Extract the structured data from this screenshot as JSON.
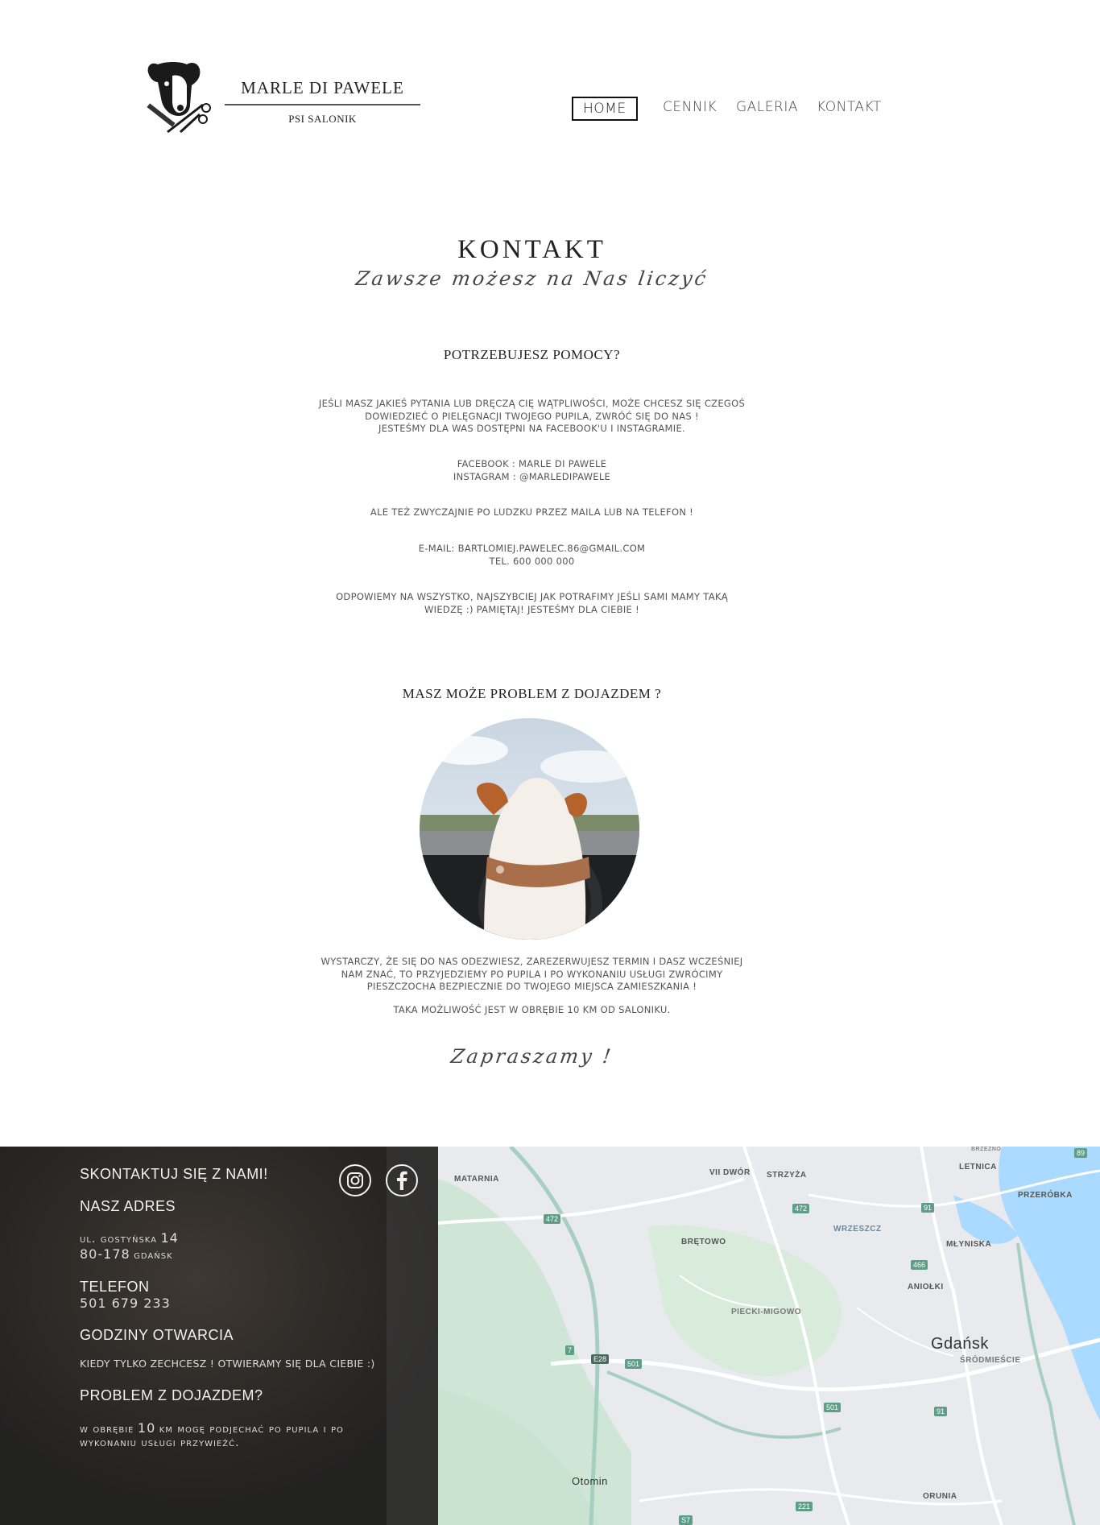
{
  "header": {
    "brand_name": "MARLE DI PAWELE",
    "brand_sub": "PSI SALONIK",
    "nav": [
      {
        "label": "HOME",
        "active": true
      },
      {
        "label": "CENNIK",
        "active": false
      },
      {
        "label": "GALERIA",
        "active": false
      },
      {
        "label": "KONTAKT",
        "active": false
      }
    ]
  },
  "main": {
    "title": "KONTAKT",
    "tagline": "Zawsze możesz na Nas liczyć",
    "help_heading": "POTRZEBUJESZ POMOCY?",
    "help_p1_l1": "JEŚLI MASZ JAKIEŚ PYTANIA LUB DRĘCZĄ CIĘ WĄTPLIWOŚCI, MOŻE CHCESZ SIĘ CZEGOŚ",
    "help_p1_l2": "DOWIEDZIEĆ O PIELĘGNACJI TWOJEGO PUPILA, ZWRÓĆ SIĘ DO NAS !",
    "help_p1_l3": "JESTEŚMY DLA WAS DOSTĘPNI NA FACEBOOK'U  I INSTAGRAMIE.",
    "facebook_line": "FACEBOOK : MARLE DI PAWELE",
    "instagram_line": "INSTAGRAM : @MARLEDIPAWELE",
    "help_p3": "ALE TEŻ ZWYCZAJNIE PO LUDZKU PRZEZ MAILA LUB NA TELEFON !",
    "email_line": "E-MAIL: BARTLOMIEJ.PAWELEC.86@GMAIL.COM",
    "tel_line": "TEL. 600 000 000",
    "help_p5_l1": "ODPOWIEMY NA WSZYSTKO, NAJSZYBCIEJ JAK POTRAFIMY JEŚLI SAMI MAMY TAKĄ",
    "help_p5_l2": "WIEDZĘ :) PAMIĘTAJ! JESTEŚMY DLA CIEBIE !",
    "transport_heading": "MASZ MOŻE PROBLEM Z DOJAZDEM ?",
    "transport_p1_l1": "WYSTARCZY, ŻE SIĘ DO NAS ODEZWIESZ, ZAREZERWUJESZ TERMIN I DASZ WCZEŚNIEJ",
    "transport_p1_l2": "NAM ZNAĆ, TO PRZYJEDZIEMY PO PUPILA I PO WYKONANIU USŁUGI ZWRÓCIMY",
    "transport_p1_l3": "PIESZCZOCHA BEZPIECZNIE DO TWOJEGO MIEJSCA ZAMIESZKANIA !",
    "transport_p2": "TAKA MOŻLIWOŚĆ JEST W OBRĘBIE 10 KM OD SALONIKU.",
    "closing": "Zapraszamy !"
  },
  "footer": {
    "contact_heading": "SKONTAKTUJ SIĘ Z NAMI!",
    "address_heading": "NASZ ADRES",
    "address_l1": "ul. gostyńska",
    "address_l1_num": "14",
    "address_l2_num": "80-178",
    "address_l2": "gdańsk",
    "phone_heading": "TELEFON",
    "phone": "501 679 233",
    "hours_heading": "GODZINY OTWARCIA",
    "hours_text": "KIEDY TYLKO ZECHCESZ ! OTWIERAMY SIĘ DLA CIEBIE :)",
    "transport_heading": "PROBLEM Z DOJAZDEM?",
    "transport_l1a": "w obrębie",
    "transport_l1_num": "10",
    "transport_l1b": "km mogę podjechać po pupila i po",
    "transport_l2": "wykonaniu usługi przywieźć.",
    "icons": [
      "instagram-icon",
      "facebook-icon"
    ]
  },
  "map": {
    "labels": [
      "MATARNIA",
      "VII DWÓR",
      "STRZYŻA",
      "LETNICA",
      "PRZERÓBKA",
      "WRZESZCZ",
      "BRĘTOWO",
      "MŁYNISKA",
      "ANIOŁKI",
      "PIECKI-MIGOWO",
      "Gdańsk",
      "ŚRÓDMIEŚCIE",
      "Otomin",
      "ORUNIA",
      "BRZEŹNO"
    ],
    "roads": [
      "472",
      "472",
      "91",
      "466",
      "7",
      "E28",
      "501",
      "501",
      "91",
      "221",
      "S7",
      "89"
    ]
  },
  "colors": {
    "footer_bg": "#2b2927",
    "map_water": "#aadaff",
    "map_road": "#ffffff",
    "road_shield": "#5f9e86"
  }
}
